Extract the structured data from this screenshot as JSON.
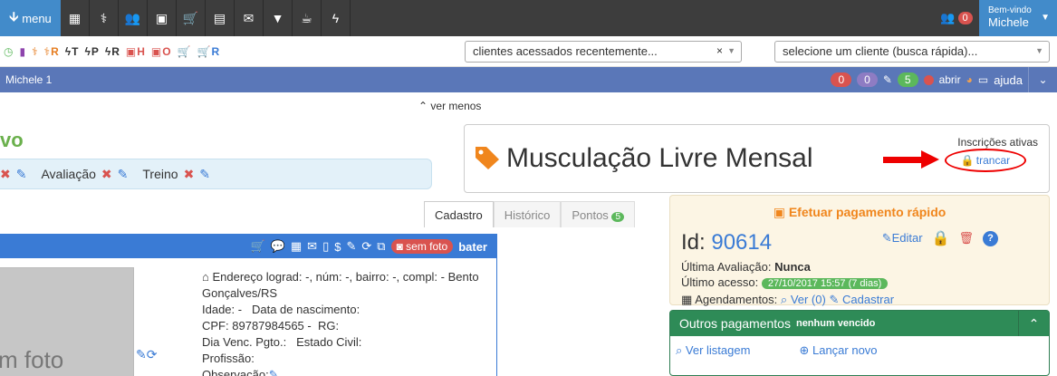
{
  "topbar": {
    "menu_label": "menu",
    "icons": [
      "calendar-icon",
      "stethoscope-icon",
      "users-icon",
      "money-icon",
      "cart-icon",
      "file-icon",
      "envelope-icon",
      "filter-icon",
      "coffee-icon",
      "bolt-icon"
    ],
    "users_count": "0",
    "welcome_small": "Bem-vindo",
    "welcome_name": "Michele"
  },
  "subbar": {
    "quick": [
      {
        "icon": "clock-icon",
        "label": "",
        "color": "#5cb85c"
      },
      {
        "icon": "bookmark-icon",
        "label": "",
        "color": "#8e44ad"
      },
      {
        "icon": "stethoscope-icon",
        "label": "",
        "color": "#e67e22"
      },
      {
        "icon": "stethoscope-icon",
        "label": "R",
        "color": "#e67e22"
      },
      {
        "icon": "bolt-icon",
        "label": "T",
        "color": "#333333"
      },
      {
        "icon": "bolt-icon",
        "label": "P",
        "color": "#333333"
      },
      {
        "icon": "bolt-icon",
        "label": "R",
        "color": "#333333"
      },
      {
        "icon": "money-icon",
        "label": "H",
        "color": "#d9534f"
      },
      {
        "icon": "money-icon",
        "label": "O",
        "color": "#d9534f"
      },
      {
        "icon": "cart-icon",
        "label": "",
        "color": "#3a7bd5"
      },
      {
        "icon": "cart-icon",
        "label": "R",
        "color": "#3a7bd5"
      }
    ],
    "recent_select": "clientes acessados recentemente...",
    "quick_search_select": "selecione um cliente (busca rápida)..."
  },
  "bluebar": {
    "title": "Michele 1",
    "badge_red": "0",
    "badge_purple": "0",
    "badge_green": "5",
    "abrir": "abrir",
    "ajuda": "ajuda"
  },
  "ver_menos": "ver menos",
  "left_title": "vo",
  "eval_items": [
    "Avaliação",
    "Treino"
  ],
  "plan": {
    "title": "Musculação Livre Mensal",
    "inscricoes": "Inscrições ativas",
    "trancar": "trancar"
  },
  "tabs": [
    {
      "label": "Cadastro",
      "active": true
    },
    {
      "label": "Histórico",
      "active": false
    },
    {
      "label": "Pontos",
      "active": false,
      "badge": "5"
    }
  ],
  "client": {
    "sem_foto": "sem foto",
    "bater": "bater",
    "photo_text": "m foto",
    "endereco_label": "Endereço",
    "endereco_value": "lograd: -, núm: -, bairro: -, compl: - Bento Gonçalves/RS",
    "idade_label": "Idade:",
    "idade_value": "-",
    "nasc_label": "Data de nascimento:",
    "cpf_label": "CPF:",
    "cpf_value": "89787984565 -",
    "rg_label": "RG:",
    "venc_label": "Dia Venc. Pgto.:",
    "civil_label": "Estado Civil:",
    "profissao_label": "Profissão:",
    "obs_label": "Observação:",
    "obs_value": "..."
  },
  "payment": {
    "title": "Efetuar pagamento rápido",
    "id_label": "Id:",
    "id_value": "90614",
    "editar": "Editar",
    "ultima_avaliacao_label": "Última Avaliação:",
    "ultima_avaliacao_value": "Nunca",
    "ultimo_acesso_label": "Último acesso:",
    "ultimo_acesso_value": "27/10/2017 15:57 (7 dias)",
    "agendamentos_label": "Agendamentos:",
    "ver_label": "Ver (0)",
    "cadastrar_label": "Cadastrar"
  },
  "outros": {
    "title": "Outros pagamentos",
    "subtitle": "nenhum vencido",
    "ver_listagem": "Ver listagem",
    "lancar_novo": "Lançar novo"
  }
}
